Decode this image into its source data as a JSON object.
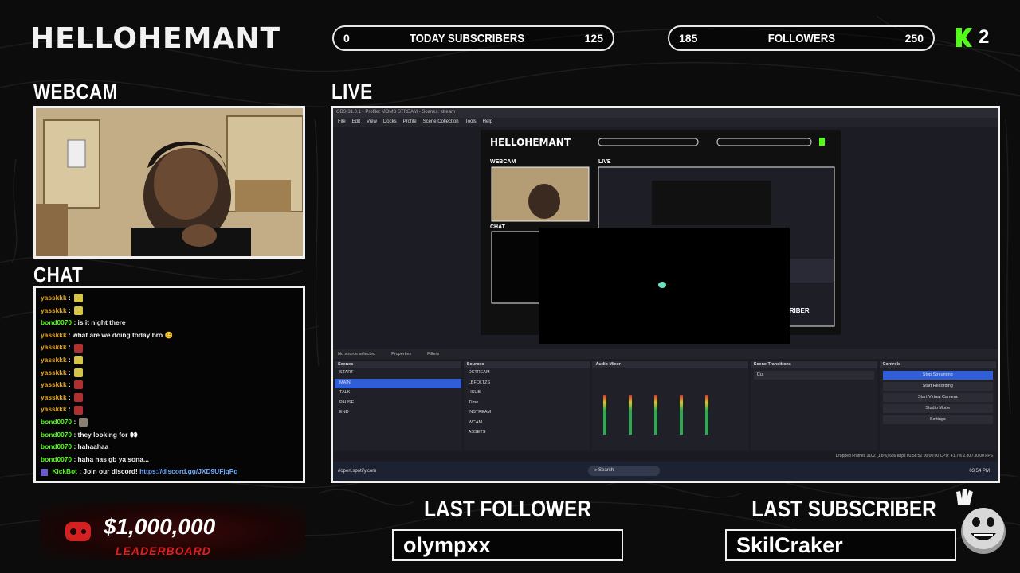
{
  "brand": "HELLOHEMANT",
  "subscribers_bar": {
    "min": "0",
    "label": "TODAY SUBSCRIBERS",
    "max": "125"
  },
  "followers_bar": {
    "min": "185",
    "label": "FOLLOWERS",
    "max": "250"
  },
  "kick": {
    "count": "2",
    "color": "#53fc18"
  },
  "sections": {
    "webcam": "WEBCAM",
    "chat": "CHAT",
    "live": "LIVE"
  },
  "chat": [
    {
      "user": "yasskkk",
      "msg": ":",
      "emote": "y",
      "color": "orange"
    },
    {
      "user": "yasskkk",
      "msg": ":",
      "emote": "y",
      "color": "orange"
    },
    {
      "user": "bond0070",
      "msg": ": is it night there",
      "emote": "",
      "color": "green"
    },
    {
      "user": "yasskkk",
      "msg": ": what are we doing today bro 😊",
      "emote": "",
      "color": "orange"
    },
    {
      "user": "yasskkk",
      "msg": ":",
      "emote": "r",
      "color": "orange"
    },
    {
      "user": "yasskkk",
      "msg": ":",
      "emote": "y",
      "color": "orange"
    },
    {
      "user": "yasskkk",
      "msg": ":",
      "emote": "y",
      "color": "orange"
    },
    {
      "user": "yasskkk",
      "msg": ":",
      "emote": "r",
      "color": "orange"
    },
    {
      "user": "yasskkk",
      "msg": ":",
      "emote": "r",
      "color": "orange"
    },
    {
      "user": "yasskkk",
      "msg": ":",
      "emote": "r",
      "color": "orange"
    },
    {
      "user": "bond0070",
      "msg": ":",
      "emote": "g",
      "color": "green"
    },
    {
      "user": "bond0070",
      "msg": ": they looking for 👀",
      "emote": "",
      "color": "green"
    },
    {
      "user": "bond0070",
      "msg": ": hahaahaa",
      "emote": "",
      "color": "green"
    },
    {
      "user": "bond0070",
      "msg": ": haha has gb ya sona...",
      "emote": "",
      "color": "green"
    }
  ],
  "kickbot": {
    "user": "KickBot",
    "msg": ": Join our discord!",
    "link": "https://discord.gg/JXD9UFjqPq"
  },
  "obs": {
    "title": "OBS 31.0.1 - Profile: MOMS STREAM - Scenes: stream",
    "menu": [
      "File",
      "Edit",
      "View",
      "Docks",
      "Profile",
      "Scene Collection",
      "Tools",
      "Help"
    ],
    "no_source": "No source selected",
    "properties": "Properties",
    "filters": "Filters",
    "scenes_title": "Scenes",
    "scenes": [
      "START",
      "MAIN",
      "TALK",
      "PAUSE",
      "END"
    ],
    "sources_title": "Sources",
    "sources": [
      "DSTREAM",
      "LBFOLTZS",
      "HSUB",
      "TIme",
      "INSTREAM",
      "WCAM",
      "ASSETS"
    ],
    "mixer_title": "Audio Mixer",
    "transitions_title": "Scene Transitions",
    "transition": "Cut",
    "controls_title": "Controls",
    "controls": [
      "Stop Streaming",
      "Start Recording",
      "Start Virtual Camera",
      "Studio Mode",
      "Settings"
    ],
    "status": "Dropped Frames 3102 (1.8%)   689 kbps   01:58:52   00:00:00   CPU: 41.7%   2.80 / 30.00 FPS",
    "taskbar_search": "Search",
    "taskbar_url": "//open.spotify.com",
    "clock": "03:54 PM"
  },
  "leaderboard": {
    "amount": "$1,000,000",
    "label": "LEADERBOARD",
    "accent": "#e02020"
  },
  "last_follower": {
    "title": "LAST FOLLOWER",
    "name": "olympxx"
  },
  "last_subscriber": {
    "title": "LAST SUBSCRIBER",
    "name": "SkilCraker"
  }
}
